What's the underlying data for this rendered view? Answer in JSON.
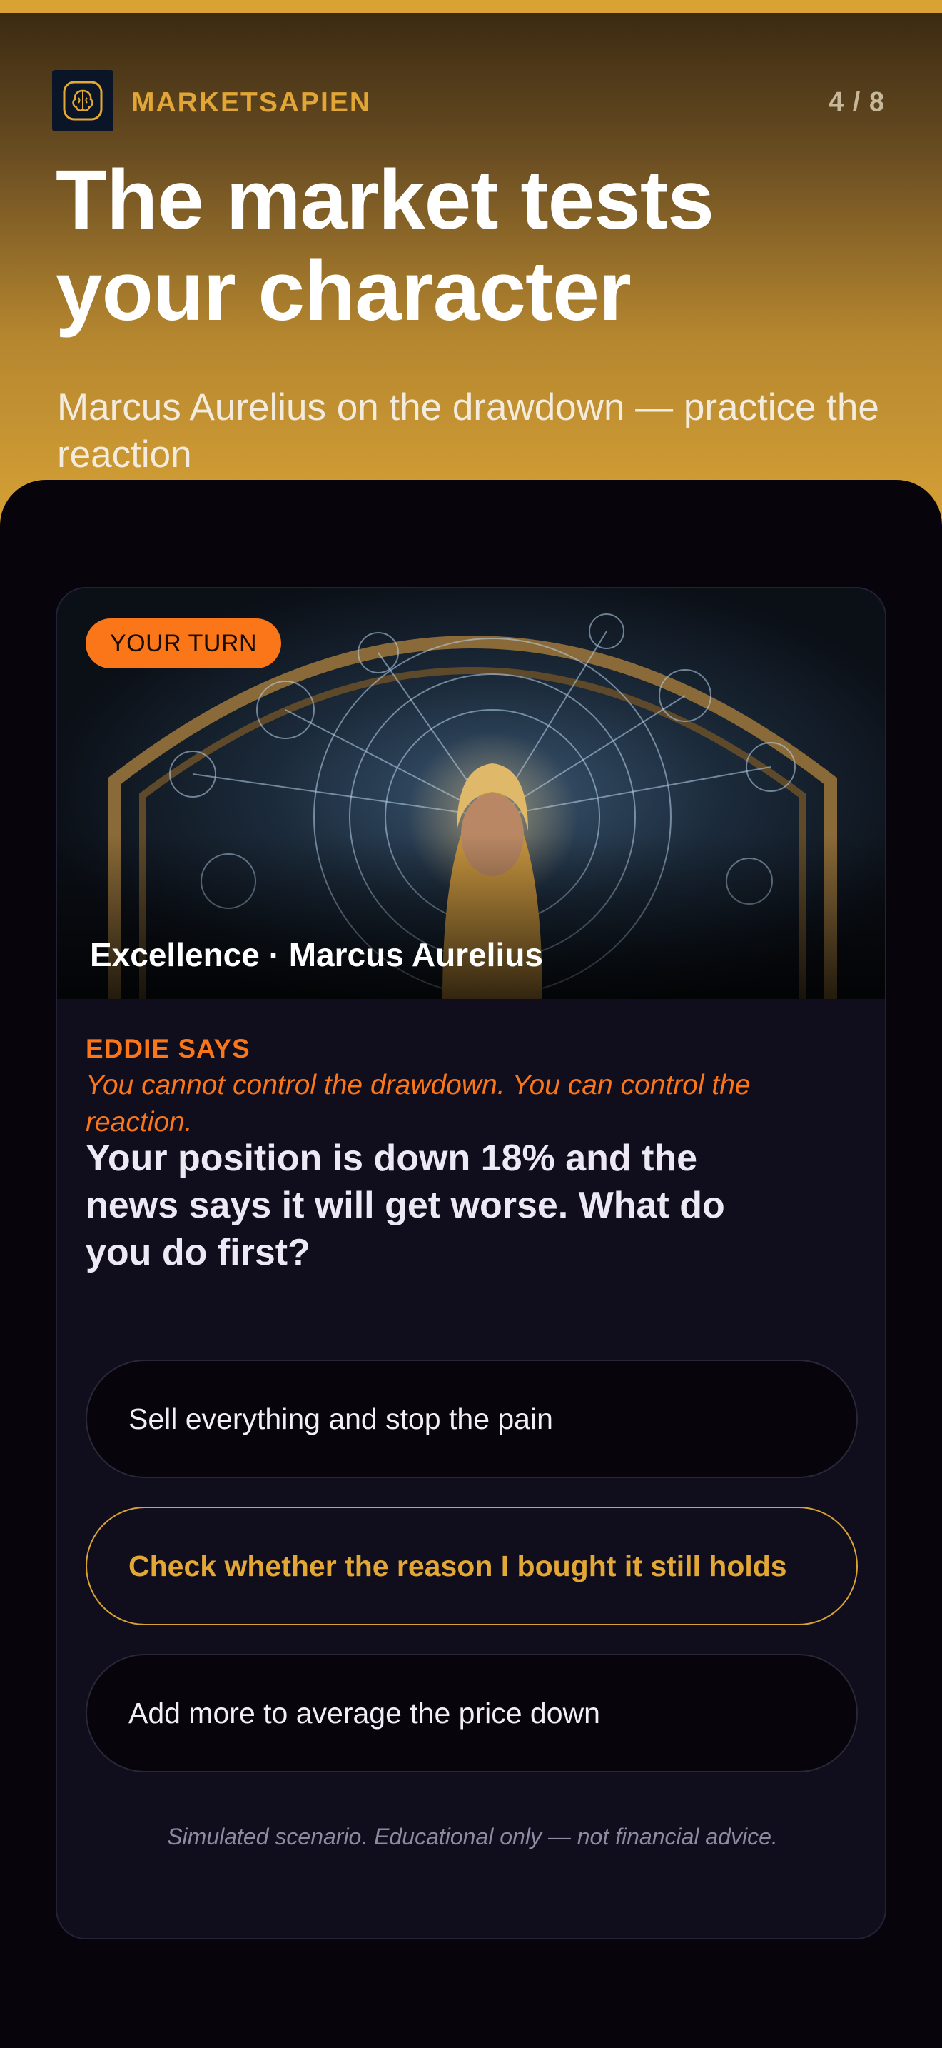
{
  "app": {
    "brand": "MARKETSAPIEN",
    "progress": "4 / 8",
    "logo_icon": "brain-icon"
  },
  "hero": {
    "title": "The market tests your character",
    "subtitle": "Marcus Aurelius on the drawdown — practice the reaction"
  },
  "card": {
    "badge": "YOUR TURN",
    "image_caption": "Excellence · Marcus Aurelius",
    "speaker_label": "EDDIE SAYS",
    "quote": "You cannot control the drawdown. You can control the reaction.",
    "question": "Your position is down 18% and the news says it will get worse. What do you do first?",
    "options": [
      {
        "label": "Sell everything and stop the pain",
        "selected": false
      },
      {
        "label": "Check whether the reason I bought it still holds",
        "selected": true
      },
      {
        "label": "Add more to average the price down",
        "selected": false
      }
    ],
    "disclaimer": "Simulated scenario. Educational only — not financial advice."
  },
  "colors": {
    "accent_gold": "#d9a334",
    "accent_orange": "#fb7619",
    "background": "#07050b",
    "card": "#100e1d"
  }
}
